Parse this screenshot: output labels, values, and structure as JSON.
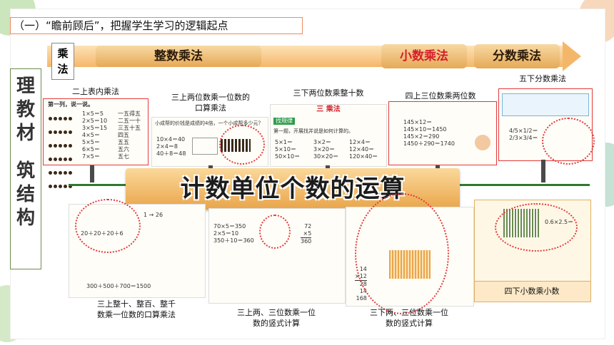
{
  "heading": "（一）“瞻前顾后”，把握学生学习的逻辑起点",
  "arrow": {
    "chengfa": "乘法",
    "integer": "整数乘法",
    "decimal": "小数乘法",
    "fraction": "分数乘法"
  },
  "side_label": {
    "line1": [
      "理",
      "教",
      "材"
    ],
    "line2": [
      "筑",
      "结",
      "构"
    ]
  },
  "banner": "计数单位个数的运算",
  "captions": {
    "g2": "二上表内乘法",
    "g3a_1": "三上两位数乘一位数的",
    "g3a_2": "口算乘法",
    "g3b": "三下两位数乘整十数",
    "g4a": "四上三位数乘两位数",
    "g5": "五下分数乘法",
    "bl_1": "三上整十、整百、整千",
    "bl_2": "数乘一位数的口算乘法",
    "bm_1": "三上两、三位数乘一位",
    "bm_2": "数的竖式计算",
    "bm2_1": "三下两、三位数乘一位",
    "bm2_2": "数的竖式计算",
    "g4b": "四下小数乘小数"
  },
  "panel_text": {
    "p1_title": "第一列，说一说。",
    "p1_rows": [
      "1×5＝5",
      "2×5＝10",
      "3×5＝15",
      "4×5＝",
      "5×5＝",
      "6×5＝",
      "7×5＝"
    ],
    "p1_right": [
      "一五得五",
      "二五一十",
      "三五十五",
      "四五",
      "五五",
      "五六",
      "五七"
    ],
    "p2_q": "小成帮的价钱是成绩的4倍，一个小成帮多少元？",
    "p2_rows": [
      "10×4＝40",
      "2×4＝8",
      "40＋8＝48"
    ],
    "p3_title": "三  乘法",
    "p3_tag": "找规律",
    "p3_line": "第一题，开展找并说是如何计算的。",
    "p3_rows": [
      "5×1＝",
      "3×2＝",
      "12×4＝",
      "5×10＝",
      "3×20＝",
      "12×40＝",
      "50×10＝",
      "30×20＝",
      "120×40＝"
    ],
    "p4_rows": [
      "145×12＝",
      "145×10＝1450",
      "145×2＝290",
      "1450＋290＝1740"
    ],
    "bl_row1": "1 → 26",
    "bl_row2": "20＋20＋20＋6",
    "bl_sum": "300＋500＋700＝1500",
    "bm_rows": [
      "70×5＝350",
      "2×5＝10",
      "350＋10＝360"
    ],
    "bm_col": [
      "72",
      "×5",
      "360"
    ],
    "bm2_nums": [
      "14",
      "×12",
      "28",
      "14",
      "168"
    ],
    "g4b_bubble": "0.6×2.5＝",
    "g5_rows": [
      "4/5×1/2＝",
      "2/3×3/4＝"
    ]
  }
}
